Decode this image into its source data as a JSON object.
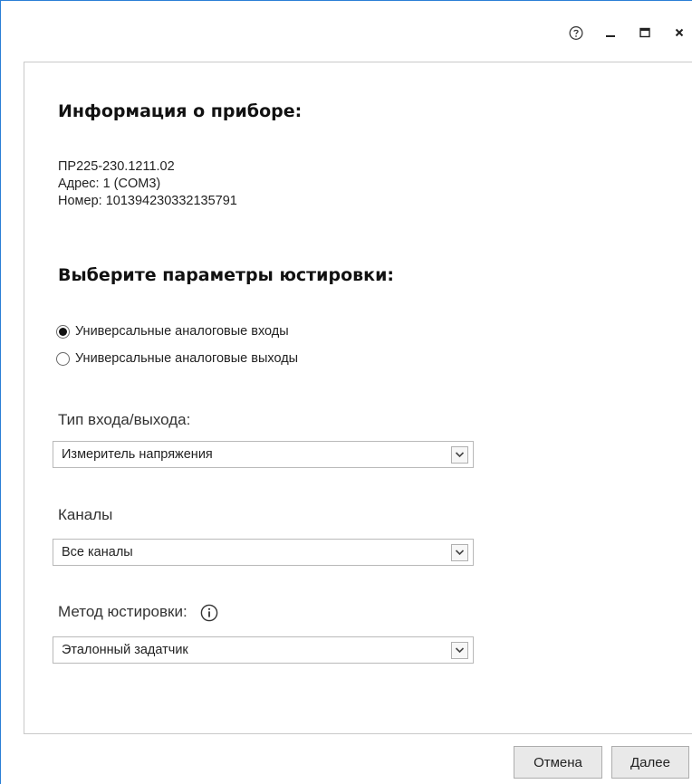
{
  "window": {
    "controls": {
      "help_icon": "help-circle-icon",
      "minimize_icon": "minimize-icon",
      "maximize_icon": "maximize-icon",
      "close_icon": "close-icon"
    }
  },
  "device_info": {
    "heading": "Информация о приборе:",
    "model": "ПР225-230.1211.02",
    "address": "Адрес: 1 (COM3)",
    "number": "Номер: 101394230332135791"
  },
  "params": {
    "heading": "Выберите параметры юстировки:",
    "radios": [
      {
        "label": "Универсальные аналоговые входы",
        "checked": true
      },
      {
        "label": "Универсальные аналоговые выходы",
        "checked": false
      }
    ]
  },
  "io_type": {
    "label": "Тип входа/выхода:",
    "value": "Измеритель напряжения"
  },
  "channels": {
    "label": "Каналы",
    "value": "Все каналы"
  },
  "method": {
    "label": "Метод юстировки:",
    "value": "Эталонный задатчик",
    "info_icon": "info-circle-icon"
  },
  "buttons": {
    "cancel": "Отмена",
    "next": "Далее"
  },
  "colors": {
    "window_border": "#2b7fd6",
    "panel_border": "#c9c9c9",
    "button_bg": "#e9e9e9"
  }
}
